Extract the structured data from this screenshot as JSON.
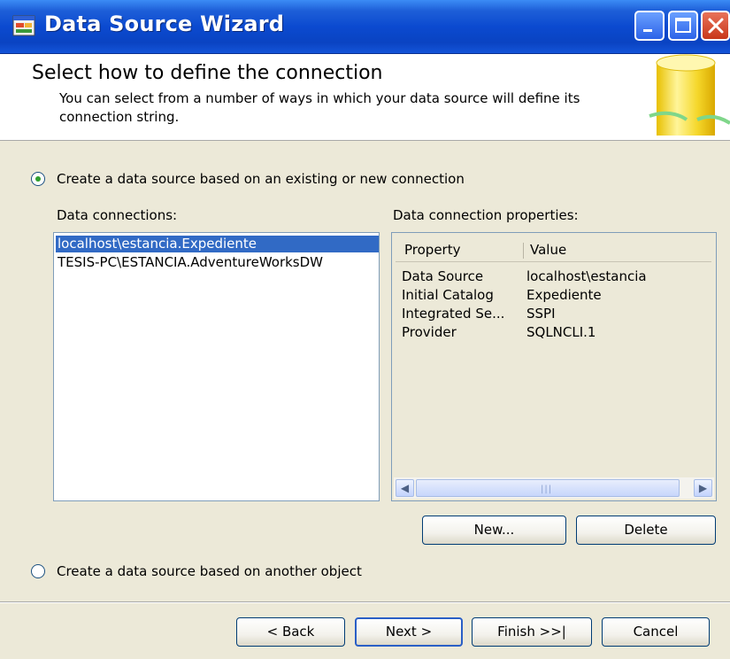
{
  "window": {
    "title": "Data Source Wizard",
    "icon": "app-window-icon",
    "controls": [
      "minimize-icon",
      "maximize-icon",
      "close-icon"
    ]
  },
  "header": {
    "title": "Select how to define the connection",
    "description": "You can select from a number of ways in which your data source will define its connection string."
  },
  "options": {
    "existing_connection_label": "Create a data source based on an existing or new connection",
    "existing_connection_selected": true,
    "other_object_label": "Create a data source based on another object",
    "other_object_selected": false
  },
  "connections": {
    "label": "Data connections:",
    "items": [
      {
        "label": "localhost\\estancia.Expediente",
        "selected": true
      },
      {
        "label": "TESIS-PC\\ESTANCIA.AdventureWorksDW",
        "selected": false
      }
    ]
  },
  "properties": {
    "label": "Data connection properties:",
    "columns": [
      "Property",
      "Value"
    ],
    "rows": [
      {
        "property": "Data Source",
        "value": "localhost\\estancia"
      },
      {
        "property": "Initial Catalog",
        "value": "Expediente"
      },
      {
        "property": "Integrated Se...",
        "value": "SSPI"
      },
      {
        "property": "Provider",
        "value": "SQLNCLI.1"
      }
    ]
  },
  "buttons": {
    "new": "New...",
    "delete": "Delete",
    "back": "< Back",
    "next": "Next >",
    "finish": "Finish >>|",
    "cancel": "Cancel"
  },
  "colors": {
    "title_bar": "#0b4ad0",
    "selection": "#316ac5",
    "dialog_bg": "#ece9d8"
  }
}
